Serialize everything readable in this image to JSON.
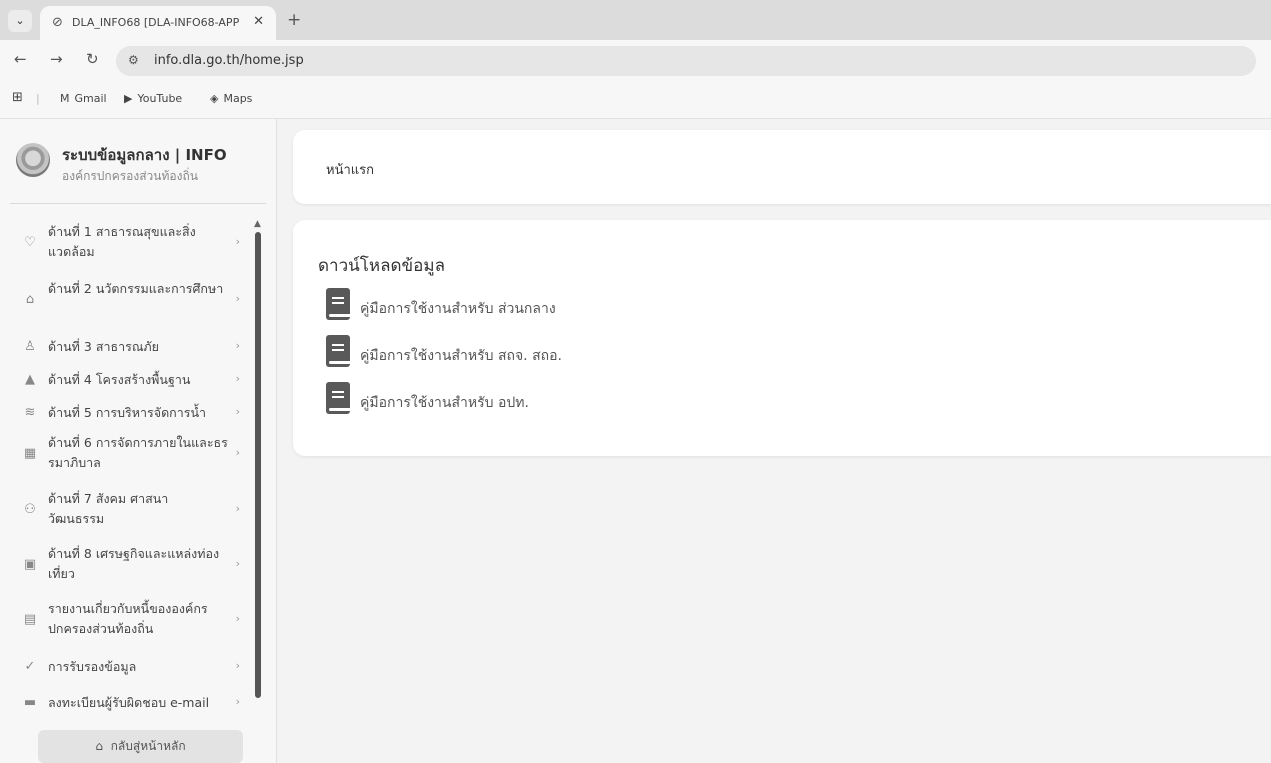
{
  "browser": {
    "tab_title": "DLA_INFO68 [DLA-INFO68-APP",
    "url": "info.dla.go.th/home.jsp",
    "bookmarks": [
      {
        "label": "Gmail",
        "icon": "gmail-icon"
      },
      {
        "label": "YouTube",
        "icon": "youtube-icon"
      },
      {
        "label": "Maps",
        "icon": "maps-icon"
      }
    ]
  },
  "sidebar": {
    "brand_title": "ระบบข้อมูลกลาง | INFO",
    "brand_subtitle": "องค์กรปกครองส่วนท้องถิ่น",
    "items": [
      {
        "label": "ด้านที่ 1 สาธารณสุขและสิ่งแวดล้อม",
        "icon": "heart-icon"
      },
      {
        "label": "ด้านที่ 2 นวัตกรรมและการศึกษา",
        "icon": "education-icon"
      },
      {
        "label": "ด้านที่ 3 สาธารณภัย",
        "icon": "people-icon"
      },
      {
        "label": "ด้านที่ 4 โครงสร้างพื้นฐาน",
        "icon": "road-icon"
      },
      {
        "label": "ด้านที่ 5 การบริหารจัดการน้ำ",
        "icon": "water-icon"
      },
      {
        "label": "ด้านที่ 6 การจัดการภายในและธรรมาภิบาล",
        "icon": "building-icon"
      },
      {
        "label": "ด้านที่ 7 สังคม ศาสนา วัฒนธรรม",
        "icon": "community-icon"
      },
      {
        "label": "ด้านที่ 8 เศรษฐกิจและแหล่งท่องเที่ยว",
        "icon": "money-icon"
      },
      {
        "label": "รายงานเกี่ยวกับหนี้ขององค์กรปกครองส่วนท้องถิ่น",
        "icon": "report-icon"
      },
      {
        "label": "การรับรองข้อมูล",
        "icon": "check-icon"
      },
      {
        "label": "ลงทะเบียนผู้รับผิดชอบ e-mail",
        "icon": "email-icon"
      }
    ],
    "home_button": "กลับสู่หน้าหลัก"
  },
  "main": {
    "breadcrumb": "หน้าแรก",
    "section_title": "ดาวน์โหลดข้อมูล",
    "downloads": [
      {
        "label": "คู่มือการใช้งานสำหรับ ส่วนกลาง",
        "icon": "book-icon"
      },
      {
        "label": "คู่มือการใช้งานสำหรับ สถจ. สถอ.",
        "icon": "book-icon"
      },
      {
        "label": "คู่มือการใช้งานสำหรับ อปท.",
        "icon": "book-icon"
      }
    ]
  },
  "colors": {
    "page_background": "#f3f3f3",
    "card_background": "#ffffff",
    "sidebar_background": "#f7f7f7",
    "scrollbar": "#555555",
    "book_icon": "#595959"
  }
}
